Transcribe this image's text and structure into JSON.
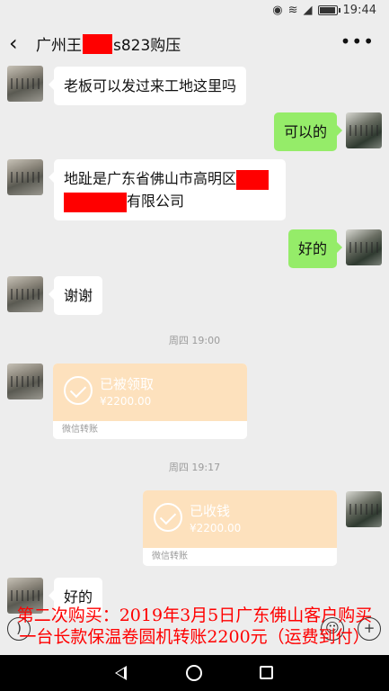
{
  "status_bar": {
    "time": "19:44"
  },
  "header": {
    "title_prefix": "广州王",
    "title_suffix": "s823购压"
  },
  "messages": {
    "m1": "老板可以发过来工地这里吗",
    "m2": "可以的",
    "m3_line1": "地趾是广东省佛山市高明区",
    "m3_line2": "有限公司",
    "m4": "好的",
    "m5": "谢谢",
    "time1": "周四 19:00",
    "transfer1": {
      "status": "已被领取",
      "amount": "¥2200.00",
      "label": "微信转账"
    },
    "time2": "周四 19:17",
    "transfer2": {
      "status": "已收钱",
      "amount": "¥2200.00",
      "label": "微信转账"
    },
    "m6": "好的"
  },
  "overlay": {
    "line1": "第二次购买：2019年3月5日广东佛山客户购买",
    "line2": "一台长款保温卷圆机转账2200元（运费到付）"
  },
  "colors": {
    "accent_green": "#95ec69",
    "transfer_orange": "#fde1bd",
    "redaction": "#ff0000"
  },
  "icons": [
    "back-arrow-icon",
    "more-icon",
    "voice-icon",
    "emoji-icon",
    "plus-icon",
    "nav-back-icon",
    "nav-home-icon",
    "nav-recent-icon"
  ]
}
